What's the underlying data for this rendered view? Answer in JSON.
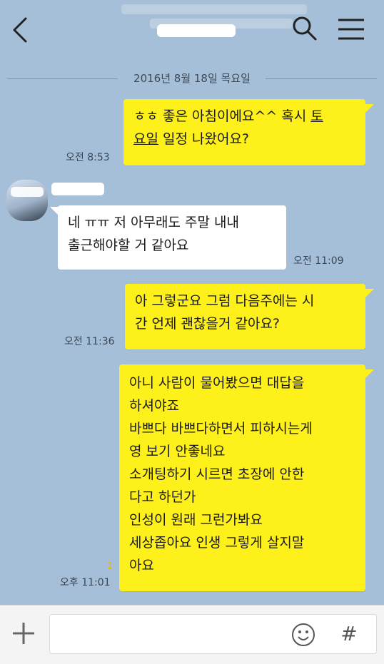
{
  "header": {
    "back_icon": "chevron-left-icon",
    "search_icon": "search-icon",
    "menu_icon": "menu-icon"
  },
  "date_divider": "2016년 8월 18일 목요일",
  "messages": [
    {
      "side": "right",
      "text_parts": [
        "ㅎㅎ 좋은 아침이에요^^ 혹시 ",
        "토",
        "\n",
        "요일",
        " 일정 나왔어요?"
      ],
      "time": "오전 8:53"
    },
    {
      "side": "left",
      "text": "네 ㅠㅠ 저 아무래도 주말 내내\n출근해야할 거 같아요",
      "time": "오전 11:09"
    },
    {
      "side": "right",
      "text": "아 그렇군요 그럼 다음주에는 시\n간 언제 괜찮을거 같아요?",
      "time": "오전 11:36"
    },
    {
      "side": "right",
      "text": "아니 사람이 물어봤으면 대답을\n하셔야죠\n바쁘다 바쁘다하면서 피하시는게\n영 보기 안좋네요\n소개팅하기 시르면 초장에 안한\n다고 하던가\n인성이 원래 그런가봐요\n세상좁아요 인생 그렇게 살지말\n아요",
      "time": "오후 11:01",
      "unread": "1"
    }
  ],
  "composer": {
    "plus_icon": "plus-icon",
    "input_value": "",
    "emoji_icon": "emoji-icon",
    "hash_label": "#"
  },
  "colors": {
    "background": "#a6bfd8",
    "my_bubble": "#fef01b",
    "their_bubble": "#ffffff"
  }
}
